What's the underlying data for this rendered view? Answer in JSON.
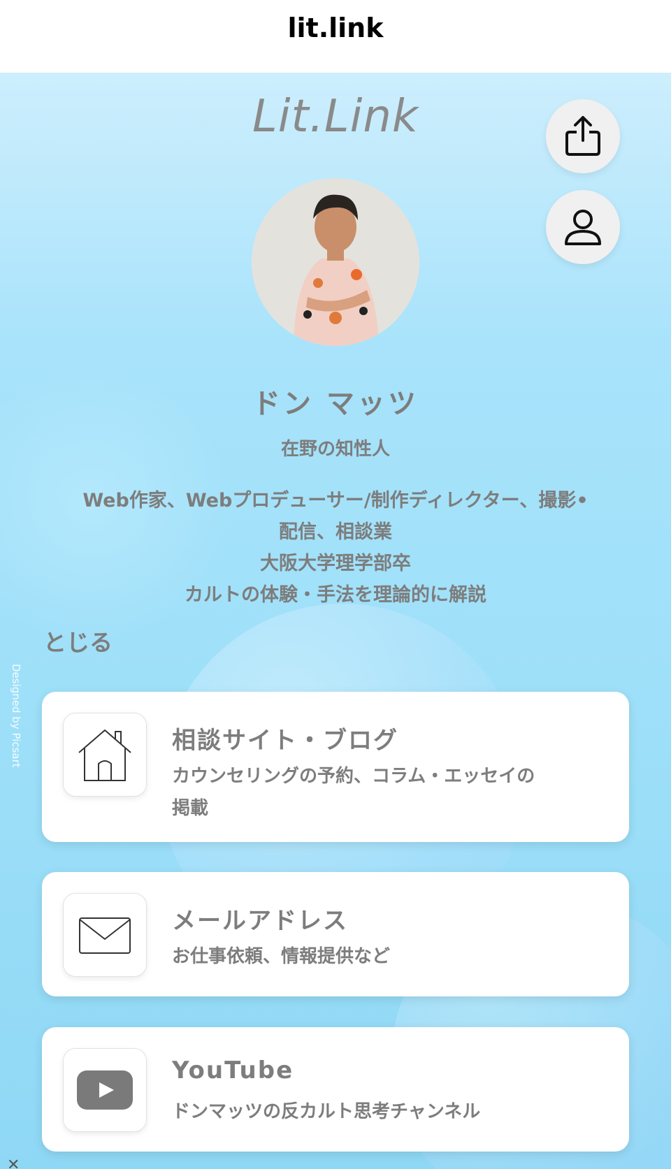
{
  "topbar": {
    "title": "lit.link"
  },
  "header": {
    "logo_text": "Lit.Link"
  },
  "actions": {
    "share_icon": "share-icon",
    "account_icon": "user-icon"
  },
  "profile": {
    "name": "ドン マッツ",
    "subtitle": "在野の知性人",
    "bio_lines": [
      "Web作家、Webプロデューサー/制作ディレクター、撮影•",
      "配信、相談業",
      "大阪大学理学部卒",
      "カルトの体験・手法を理論的に解説"
    ],
    "close_label": "とじる"
  },
  "credit": "Designed by Picsart",
  "links": [
    {
      "icon": "house-icon",
      "title": "相談サイト・ブログ",
      "desc_lines": [
        "カウンセリングの予約、コラム・エッセイの",
        "掲載"
      ]
    },
    {
      "icon": "mail-icon",
      "title": "メールアドレス",
      "desc_lines": [
        "お仕事依頼、情報提供など"
      ]
    },
    {
      "icon": "youtube-icon",
      "title": "YouTube",
      "desc_lines": [
        "ドンマッツの反カルト思考チャンネル"
      ]
    }
  ],
  "colors": {
    "text_gray": "#7d7d7d",
    "bg_light_blue": "#a8e3fb"
  }
}
